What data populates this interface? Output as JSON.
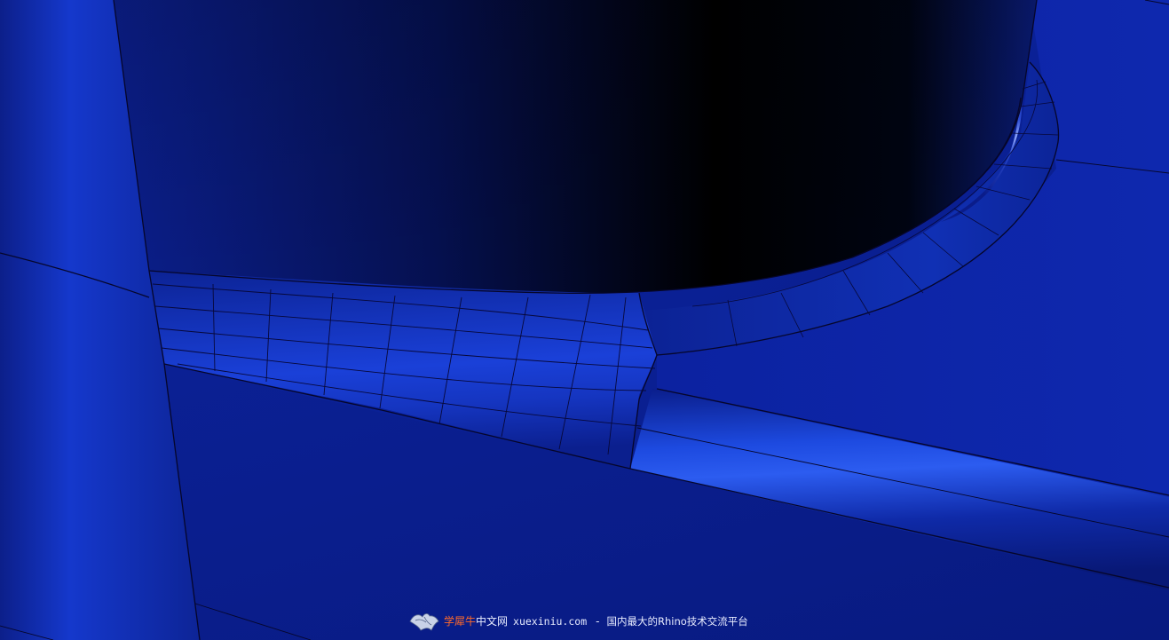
{
  "viewport": {
    "render_mode": "shaded",
    "object_color": "#0a1f8a",
    "edge_color": "#0a0a3a"
  },
  "watermark": {
    "logo_icon": "rhino-logo-icon",
    "brand": "学犀牛",
    "brand_suffix": "中文网",
    "domain": "xuexiniu.com",
    "separator": "-",
    "slogan": "国内最大的Rhino技术交流平台",
    "brand_color": "#ff6a2a",
    "text_color": "#e8ecff"
  }
}
